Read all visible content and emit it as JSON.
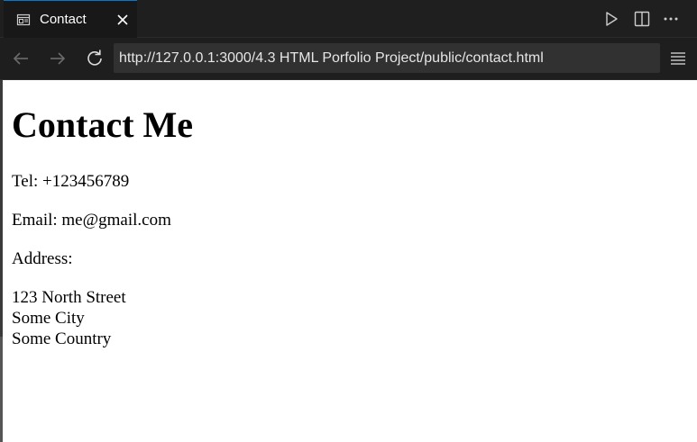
{
  "tab": {
    "label": "Contact",
    "icon": "preview-icon",
    "close_icon": "close-icon"
  },
  "toolbar": {
    "run_icon": "play-icon",
    "split_icon": "split-editor-icon",
    "more_icon": "more-icon"
  },
  "nav": {
    "back_icon": "arrow-left-icon",
    "forward_icon": "arrow-right-icon",
    "reload_icon": "reload-icon",
    "url": "http://127.0.0.1:3000/4.3 HTML Porfolio Project/public/contact.html",
    "menu_icon": "menu-icon"
  },
  "page": {
    "heading": "Contact Me",
    "tel": "Tel: +123456789",
    "email": "Email: me@gmail.com",
    "address_label": "Address:",
    "address_lines": [
      "123 North Street",
      "Some City",
      "Some Country"
    ]
  },
  "colors": {
    "titlebar_bg": "#1f1f1f",
    "navbar_bg": "#1e1e1e",
    "address_bg": "#313131",
    "tab_accent": "#0078d4"
  }
}
